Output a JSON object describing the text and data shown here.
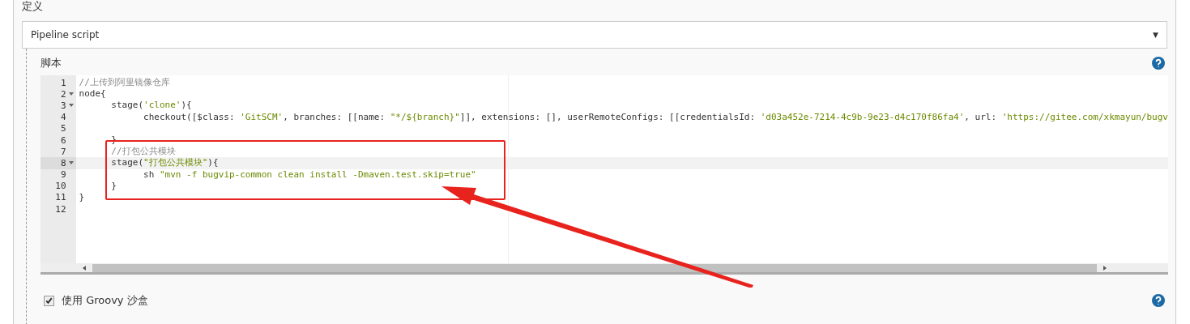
{
  "definition": {
    "label": "定义",
    "select": {
      "value": "Pipeline script",
      "caret": "▼"
    }
  },
  "script": {
    "label": "脚本",
    "editor": {
      "lines": [
        {
          "number": "1",
          "fold": false,
          "active": false,
          "tokens": [
            {
              "kind": "comment",
              "text": "//上传到阿里镜像仓库"
            }
          ]
        },
        {
          "number": "2",
          "fold": true,
          "active": false,
          "tokens": [
            {
              "kind": "plain",
              "text": "node{"
            }
          ]
        },
        {
          "number": "3",
          "fold": true,
          "active": false,
          "tokens": [
            {
              "kind": "plain",
              "text": "      stage("
            },
            {
              "kind": "string",
              "text": "'clone'"
            },
            {
              "kind": "plain",
              "text": "){"
            }
          ]
        },
        {
          "number": "4",
          "fold": false,
          "active": false,
          "tokens": [
            {
              "kind": "plain",
              "text": "            checkout([$class: "
            },
            {
              "kind": "string",
              "text": "'GitSCM'"
            },
            {
              "kind": "plain",
              "text": ", branches: [[name: "
            },
            {
              "kind": "string",
              "text": "\"*/${branch}\""
            },
            {
              "kind": "plain",
              "text": "]], extensions: [], userRemoteConfigs: [[credentialsId: "
            },
            {
              "kind": "string",
              "text": "'d03a452e-7214-4c9b-9e23-d4c170f86fa4'"
            },
            {
              "kind": "plain",
              "text": ", url: "
            },
            {
              "kind": "string",
              "text": "'https://gitee.com/xkmayun/bugv"
            }
          ]
        },
        {
          "number": "5",
          "fold": false,
          "active": false
        },
        {
          "number": "6",
          "fold": false,
          "active": false,
          "tokens": [
            {
              "kind": "plain",
              "text": "      }"
            }
          ]
        },
        {
          "number": "7",
          "fold": false,
          "active": false,
          "tokens": [
            {
              "kind": "comment",
              "text": "      //打包公共模块"
            }
          ]
        },
        {
          "number": "8",
          "fold": true,
          "active": true,
          "tokens": [
            {
              "kind": "plain",
              "text": "      stage("
            },
            {
              "kind": "string",
              "text": "\"打包公共模块\""
            },
            {
              "kind": "plain",
              "text": "){"
            }
          ]
        },
        {
          "number": "9",
          "fold": false,
          "active": false,
          "tokens": [
            {
              "kind": "plain",
              "text": "            sh "
            },
            {
              "kind": "string",
              "text": "\"mvn -f bugvip-common clean install -Dmaven.test.skip=true\""
            }
          ]
        },
        {
          "number": "10",
          "fold": false,
          "active": false,
          "tokens": [
            {
              "kind": "plain",
              "text": "      }"
            }
          ]
        },
        {
          "number": "11",
          "fold": false,
          "active": false,
          "tokens": [
            {
              "kind": "plain",
              "text": "}"
            }
          ]
        },
        {
          "number": "12",
          "fold": false,
          "active": false
        }
      ]
    }
  },
  "sandbox": {
    "label": "使用 Groovy 沙盒",
    "checked": true
  }
}
